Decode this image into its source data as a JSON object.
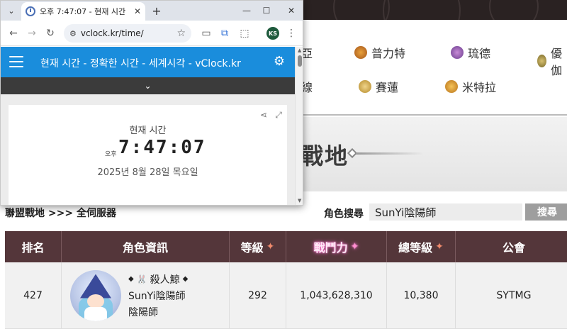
{
  "browser": {
    "tab_title": "오후 7:47:07 - 현재 시간",
    "tab_close": "✕",
    "new_tab": "+",
    "window_controls": {
      "minimize": "—",
      "maximize": "☐",
      "close": "✕"
    },
    "url": "vclock.kr/time/",
    "profile_initials": "KS",
    "icons": [
      "tab-search-icon",
      "back-arrow-icon",
      "forward-arrow-icon",
      "reload-icon",
      "site-settings-icon",
      "star-icon",
      "cast-icon",
      "translate-icon",
      "extensions-icon",
      "menu-dots-icon"
    ]
  },
  "clock_site": {
    "header_title": "현재 시간 - 정확한 시간 - 세계시각 - vClock.kr",
    "card_label": "현재 시간",
    "ampm": "오후",
    "time": "7:47:07",
    "date": "2025년 8월 28일 목요일"
  },
  "page": {
    "nav_items": [
      "普力特",
      "琉德",
      "優伽",
      "賽蓮",
      "米特拉"
    ],
    "nav_partials": [
      "亞",
      "線"
    ],
    "banner_title_partial": "戰地",
    "breadcrumb": "聯盟戰地 >>> 全伺服器",
    "search": {
      "label": "角色搜尋",
      "value": "SunYi陰陽師",
      "button": "搜尋"
    },
    "table": {
      "headers": [
        "排名",
        "角色資訊",
        "等級",
        "戰鬥力",
        "總等級",
        "公會"
      ],
      "row": {
        "rank": "427",
        "guild_name": "殺人鯨",
        "char_name": "SunYi陰陽師",
        "job": "陰陽師",
        "level": "292",
        "power": "1,043,628,310",
        "total_level": "10,380",
        "guild": "SYTMG"
      }
    },
    "colors": {
      "table_header": "#54363a",
      "clock_header": "#1a8ddc",
      "row_bg": "#f1f1f1"
    }
  }
}
